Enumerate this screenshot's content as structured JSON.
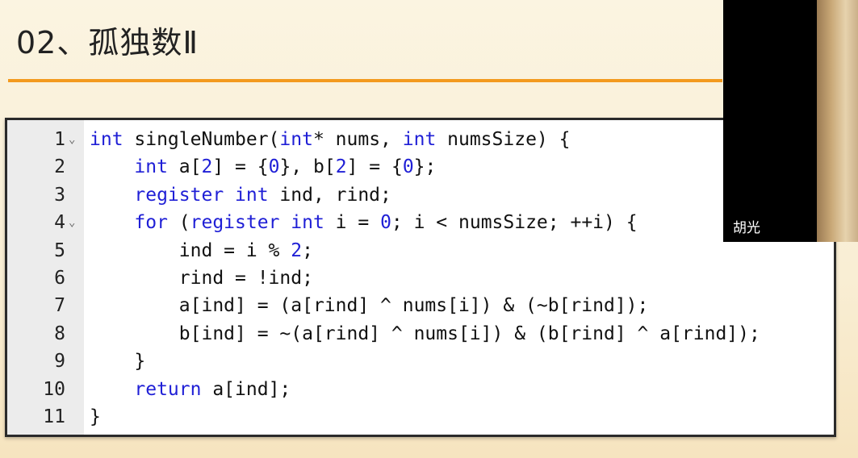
{
  "slide": {
    "title": "02、孤独数Ⅱ"
  },
  "webcam": {
    "name": "胡光"
  },
  "code": {
    "lines": [
      {
        "n": "1",
        "fold": true,
        "tokens": [
          {
            "t": "int",
            "c": "kw"
          },
          {
            "t": " singleNumber(",
            "c": ""
          },
          {
            "t": "int",
            "c": "kw"
          },
          {
            "t": "* nums, ",
            "c": ""
          },
          {
            "t": "int",
            "c": "kw"
          },
          {
            "t": " numsSize) {",
            "c": ""
          }
        ]
      },
      {
        "n": "2",
        "fold": false,
        "tokens": [
          {
            "t": "    ",
            "c": ""
          },
          {
            "t": "int",
            "c": "kw"
          },
          {
            "t": " a[",
            "c": ""
          },
          {
            "t": "2",
            "c": "num"
          },
          {
            "t": "] = {",
            "c": ""
          },
          {
            "t": "0",
            "c": "num"
          },
          {
            "t": "}, b[",
            "c": ""
          },
          {
            "t": "2",
            "c": "num"
          },
          {
            "t": "] = {",
            "c": ""
          },
          {
            "t": "0",
            "c": "num"
          },
          {
            "t": "};",
            "c": ""
          }
        ]
      },
      {
        "n": "3",
        "fold": false,
        "tokens": [
          {
            "t": "    ",
            "c": ""
          },
          {
            "t": "register int",
            "c": "kw"
          },
          {
            "t": " ind, rind;",
            "c": ""
          }
        ]
      },
      {
        "n": "4",
        "fold": true,
        "tokens": [
          {
            "t": "    ",
            "c": ""
          },
          {
            "t": "for",
            "c": "kw"
          },
          {
            "t": " (",
            "c": ""
          },
          {
            "t": "register int",
            "c": "kw"
          },
          {
            "t": " i = ",
            "c": ""
          },
          {
            "t": "0",
            "c": "num"
          },
          {
            "t": "; i < numsSize; ++i) {",
            "c": ""
          }
        ]
      },
      {
        "n": "5",
        "fold": false,
        "tokens": [
          {
            "t": "        ind = i % ",
            "c": ""
          },
          {
            "t": "2",
            "c": "num"
          },
          {
            "t": ";",
            "c": ""
          }
        ]
      },
      {
        "n": "6",
        "fold": false,
        "tokens": [
          {
            "t": "        rind = !ind;",
            "c": ""
          }
        ]
      },
      {
        "n": "7",
        "fold": false,
        "tokens": [
          {
            "t": "        a[ind] = (a[rind] ^ nums[i]) & (~b[rind]);",
            "c": ""
          }
        ]
      },
      {
        "n": "8",
        "fold": false,
        "tokens": [
          {
            "t": "        b[ind] = ~(a[rind] ^ nums[i]) & (b[rind] ^ a[rind]);",
            "c": ""
          }
        ]
      },
      {
        "n": "9",
        "fold": false,
        "tokens": [
          {
            "t": "    }",
            "c": ""
          }
        ]
      },
      {
        "n": "10",
        "fold": false,
        "tokens": [
          {
            "t": "    ",
            "c": ""
          },
          {
            "t": "return",
            "c": "kw"
          },
          {
            "t": " a[ind];",
            "c": ""
          }
        ]
      },
      {
        "n": "11",
        "fold": false,
        "tokens": [
          {
            "t": "}",
            "c": ""
          }
        ]
      }
    ]
  }
}
